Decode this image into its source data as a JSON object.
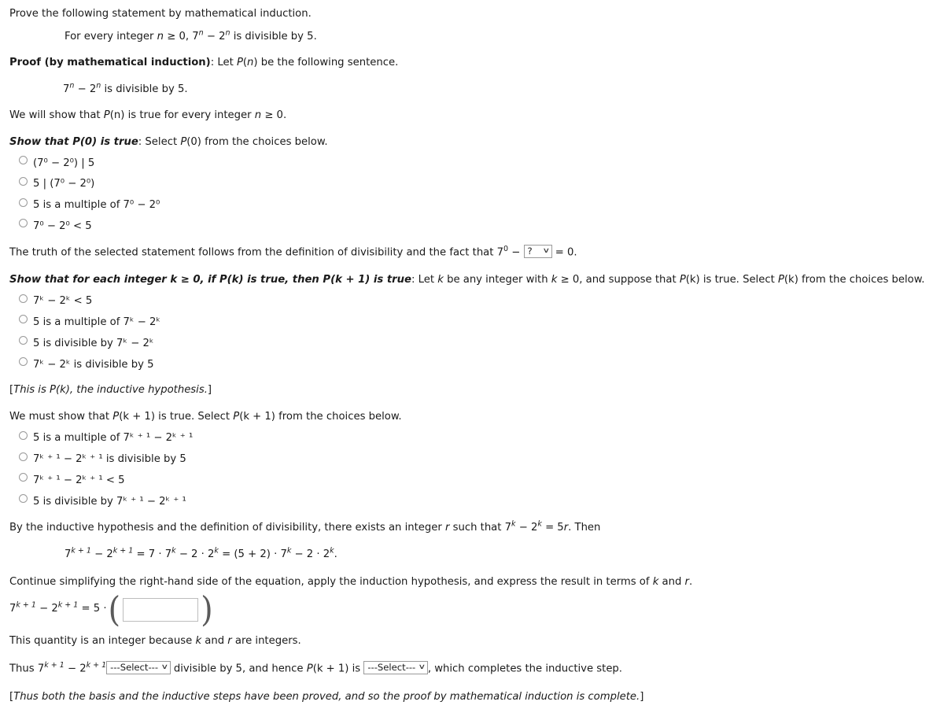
{
  "intro": {
    "line1": "Prove the following statement by mathematical induction.",
    "statement_pre": "For every integer ",
    "statement_n": "n",
    "statement_mid": " ≥ 0, 7",
    "statement_sup1": "n",
    "statement_minus": " − 2",
    "statement_sup2": "n",
    "statement_end": " is divisible by 5."
  },
  "proof_header": {
    "bold": "Proof (by mathematical induction)",
    "rest_pre": ": Let ",
    "rest_p": "P",
    "rest_paren_open": "(",
    "rest_n": "n",
    "rest_paren_close": ")",
    "rest_post": " be the following sentence."
  },
  "sentence": {
    "base1": "7",
    "sup1": "n",
    "mid": " − 2",
    "sup2": "n",
    "end": " is divisible by 5."
  },
  "will_show": {
    "pre": "We will show that ",
    "p": "P",
    "arg": "(n)",
    "post": " is true for every integer ",
    "n": "n",
    "tail": " ≥ 0."
  },
  "p0_section": {
    "header_bold": "Show that P(0) is true",
    "header_rest_pre": ": Select ",
    "header_p": "P",
    "header_arg": "(0)",
    "header_rest_post": " from the choices below.",
    "choices": [
      "(7⁰ − 2⁰) | 5",
      "5 | (7⁰ − 2⁰)",
      "5 is a multiple of 7⁰ − 2⁰",
      "7⁰ − 2⁰ < 5"
    ]
  },
  "truth_line": {
    "pre": "The truth of the selected statement follows from the definition of divisibility and the fact that 7",
    "sup": "0",
    "minus": " − ",
    "select_value": "?",
    "post": " = 0."
  },
  "pk_section": {
    "header_bold": "Show that for each integer k ≥ 0, if P(k) is true, then P(k + 1) is true",
    "header_rest_pre": ": Let ",
    "header_k1": "k",
    "header_mid1": " be any integer with ",
    "header_k2": "k",
    "header_mid2": " ≥ 0, and suppose that ",
    "header_p1": "P",
    "header_arg1": "(k)",
    "header_mid3": " is true. Select ",
    "header_p2": "P",
    "header_arg2": "(k)",
    "header_end": " from the choices below.",
    "choices": [
      "7ᵏ − 2ᵏ < 5",
      "5 is a multiple of 7ᵏ − 2ᵏ",
      "5 is divisible by 7ᵏ − 2ᵏ",
      "7ᵏ − 2ᵏ is divisible by 5"
    ]
  },
  "inductive_hypothesis_note": {
    "open": "[",
    "italic": "This is P(k), the inductive hypothesis.",
    "close": "]"
  },
  "pk1_section": {
    "header_pre": "We must show that ",
    "header_p1": "P",
    "header_arg1": "(k + 1)",
    "header_mid": " is true. Select ",
    "header_p2": "P",
    "header_arg2": "(k + 1)",
    "header_end": " from the choices below.",
    "choices": [
      "5 is a multiple of 7ᵏ ⁺ ¹ − 2ᵏ ⁺ ¹",
      "7ᵏ ⁺ ¹ − 2ᵏ ⁺ ¹ is divisible by 5",
      "7ᵏ ⁺ ¹ − 2ᵏ ⁺ ¹ < 5",
      "5 is divisible by 7ᵏ ⁺ ¹ − 2ᵏ ⁺ ¹"
    ]
  },
  "by_hypothesis": {
    "pre": "By the inductive hypothesis and the definition of divisibility, there exists an integer ",
    "r": "r",
    "mid": " such that 7",
    "sup_k1": "k",
    "minus": " − 2",
    "sup_k2": "k",
    "eq": " = 5",
    "r2": "r",
    "end": ". Then"
  },
  "equation_display": {
    "lhs_base1": "7",
    "lhs_sup1": "k + 1",
    "lhs_minus": " − 2",
    "lhs_sup2": "k + 1",
    "rhs": " = 7 · 7",
    "rhs_sup1": "k",
    "rhs_mid": " − 2 · 2",
    "rhs_sup2": "k",
    "rhs2": " = (5 + 2) · 7",
    "rhs2_sup": "k",
    "rhs3": " − 2 · 2",
    "rhs3_sup": "k",
    "period": "."
  },
  "continue_line": {
    "pre": "Continue simplifying the right-hand side of the equation, apply the induction hypothesis, and express the result in terms of ",
    "k": "k",
    "and": " and ",
    "r": "r",
    "end": "."
  },
  "answer_equation": {
    "base1": "7",
    "sup1": "k + 1",
    "minus": " − 2",
    "sup2": "k + 1",
    "equals": " = 5 · ",
    "input_value": "",
    "input_placeholder": "",
    "paren_open": "(",
    "paren_close": ")"
  },
  "integer_line": {
    "pre": "This quantity is an integer because ",
    "k": "k",
    "and": " and ",
    "r": "r",
    "end": " are integers."
  },
  "thus_line": {
    "pre": "Thus 7",
    "sup1": "k + 1",
    "minus": " − 2",
    "sup2": "k + 1",
    "select1_value": "---Select---",
    "mid": " divisible by 5, and hence ",
    "p": "P",
    "arg": "(k + 1)",
    "mid2": " is ",
    "select2_value": "---Select---",
    "end": ", which completes the inductive step."
  },
  "closing_note": {
    "open": "[",
    "italic": "Thus both the basis and the inductive steps have been proved, and so the proof by mathematical induction is complete.",
    "close": "]"
  },
  "icons": {
    "chevron_down": "∨",
    "radio": "radio-unchecked"
  },
  "colors": {
    "text": "#1a1a1a",
    "border_select": "#9a9a9a",
    "border_input": "#bdbdbd",
    "radio_border": "#999999",
    "background": "#ffffff"
  }
}
